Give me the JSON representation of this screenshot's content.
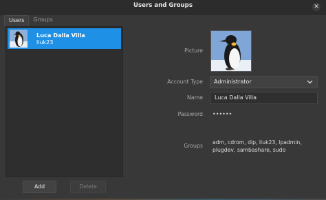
{
  "window": {
    "title": "Users and Groups",
    "close_glyph": "✕"
  },
  "tabs": [
    {
      "label": "Users",
      "active": true
    },
    {
      "label": "Groups",
      "active": false
    }
  ],
  "users": [
    {
      "full_name": "Luca Dalla Villa",
      "login": "liuk23",
      "selected": true,
      "avatar": "penguin-icon"
    }
  ],
  "buttons": {
    "add": "Add",
    "delete": "Delete"
  },
  "details": {
    "picture_label": "Picture",
    "account_type_label": "Account Type",
    "account_type_value": "Administrator",
    "name_label": "Name",
    "name_value": "Luca Dalla Villa",
    "password_label": "Password",
    "password_value": "••••••",
    "groups_label": "Groups",
    "groups_value": "adm, cdrom, dip, liuk23, lpadmin, plugdev, sambashare, sudo"
  },
  "colors": {
    "selection": "#1e90e6",
    "window_bg": "#383838"
  }
}
